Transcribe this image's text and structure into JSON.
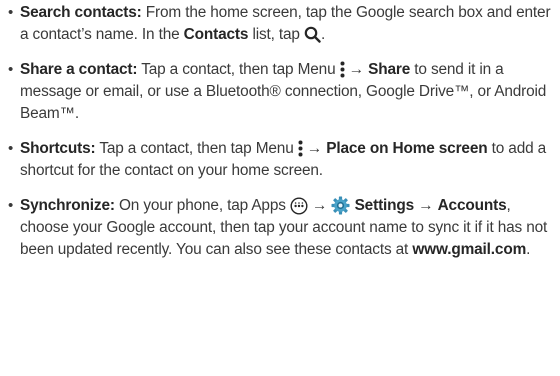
{
  "items": [
    {
      "title": "Search contacts:",
      "t1": " From the home screen, tap the Google search box and enter a contact’s name. In the ",
      "b1": "Contacts",
      "t2": " list, tap ",
      "t3": "."
    },
    {
      "title": "Share a contact:",
      "t1": " Tap a contact, then tap Menu ",
      "arrow": " → ",
      "b1": "Share",
      "t2": " to send it in a message or email, or use a Bluetooth® connection, Google Drive™, or Android Beam™."
    },
    {
      "title": "Shortcuts:",
      "t1": " Tap a contact, then tap Menu ",
      "arrow": " → ",
      "b1": "Place on Home screen",
      "t2": " to add a shortcut for the contact on your home screen."
    },
    {
      "title": "Synchronize:",
      "t1": " On your phone, tap Apps ",
      "arrow1": " → ",
      "b1": "Settings",
      "arrow2": " → ",
      "b2": "Accounts",
      "t2": ", choose your Google account, then tap your account name to sync it if it has not been updated recently. You can also see these contacts at ",
      "b3": "www.gmail.com",
      "t3": "."
    }
  ],
  "bullet": "•",
  "icons": [
    "search-icon",
    "menu-icon",
    "apps-icon",
    "settings-gear-icon"
  ],
  "colors": {
    "text": "#3a3a3a",
    "bold": "#262626",
    "icon": "#3a3a3a",
    "gear": "#3a8fb7"
  }
}
